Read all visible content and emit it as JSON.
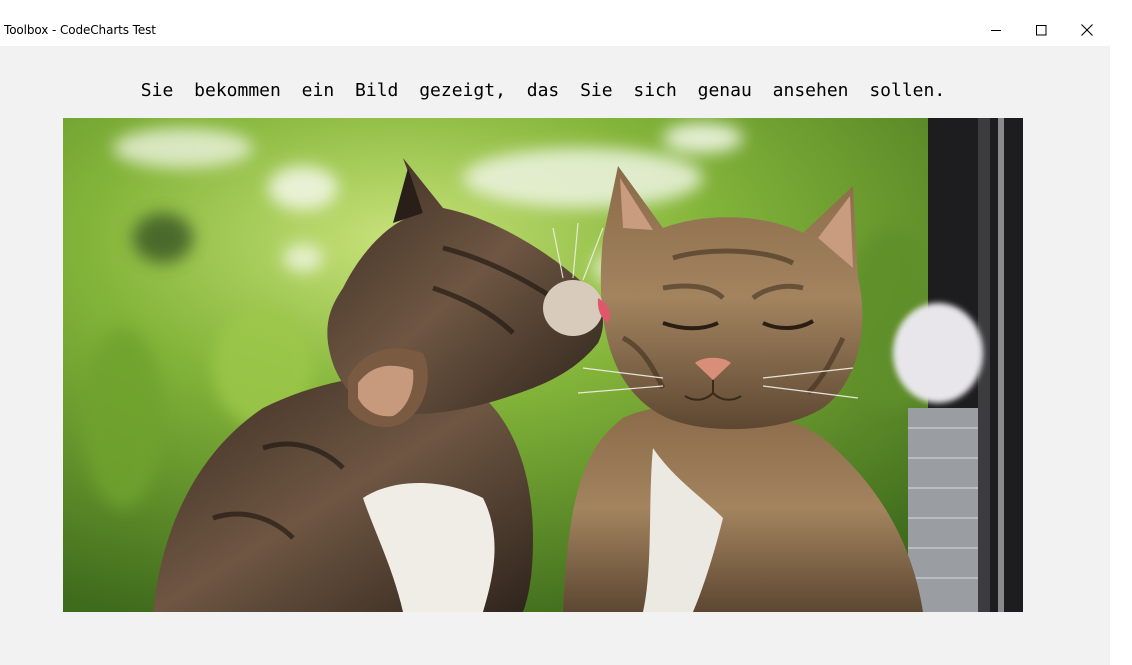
{
  "window": {
    "title": "Toolbox - CodeCharts Test",
    "controls": {
      "minimize": "minimize-icon",
      "maximize": "maximize-icon",
      "close": "close-icon"
    }
  },
  "content": {
    "instruction": "Sie bekommen ein Bild gezeigt, das Sie sich genau ansehen sollen.",
    "image": {
      "subject": "two-tabby-cats-photo"
    }
  },
  "colors": {
    "client_background": "#f2f2f2",
    "titlebar_background": "#ffffff"
  }
}
